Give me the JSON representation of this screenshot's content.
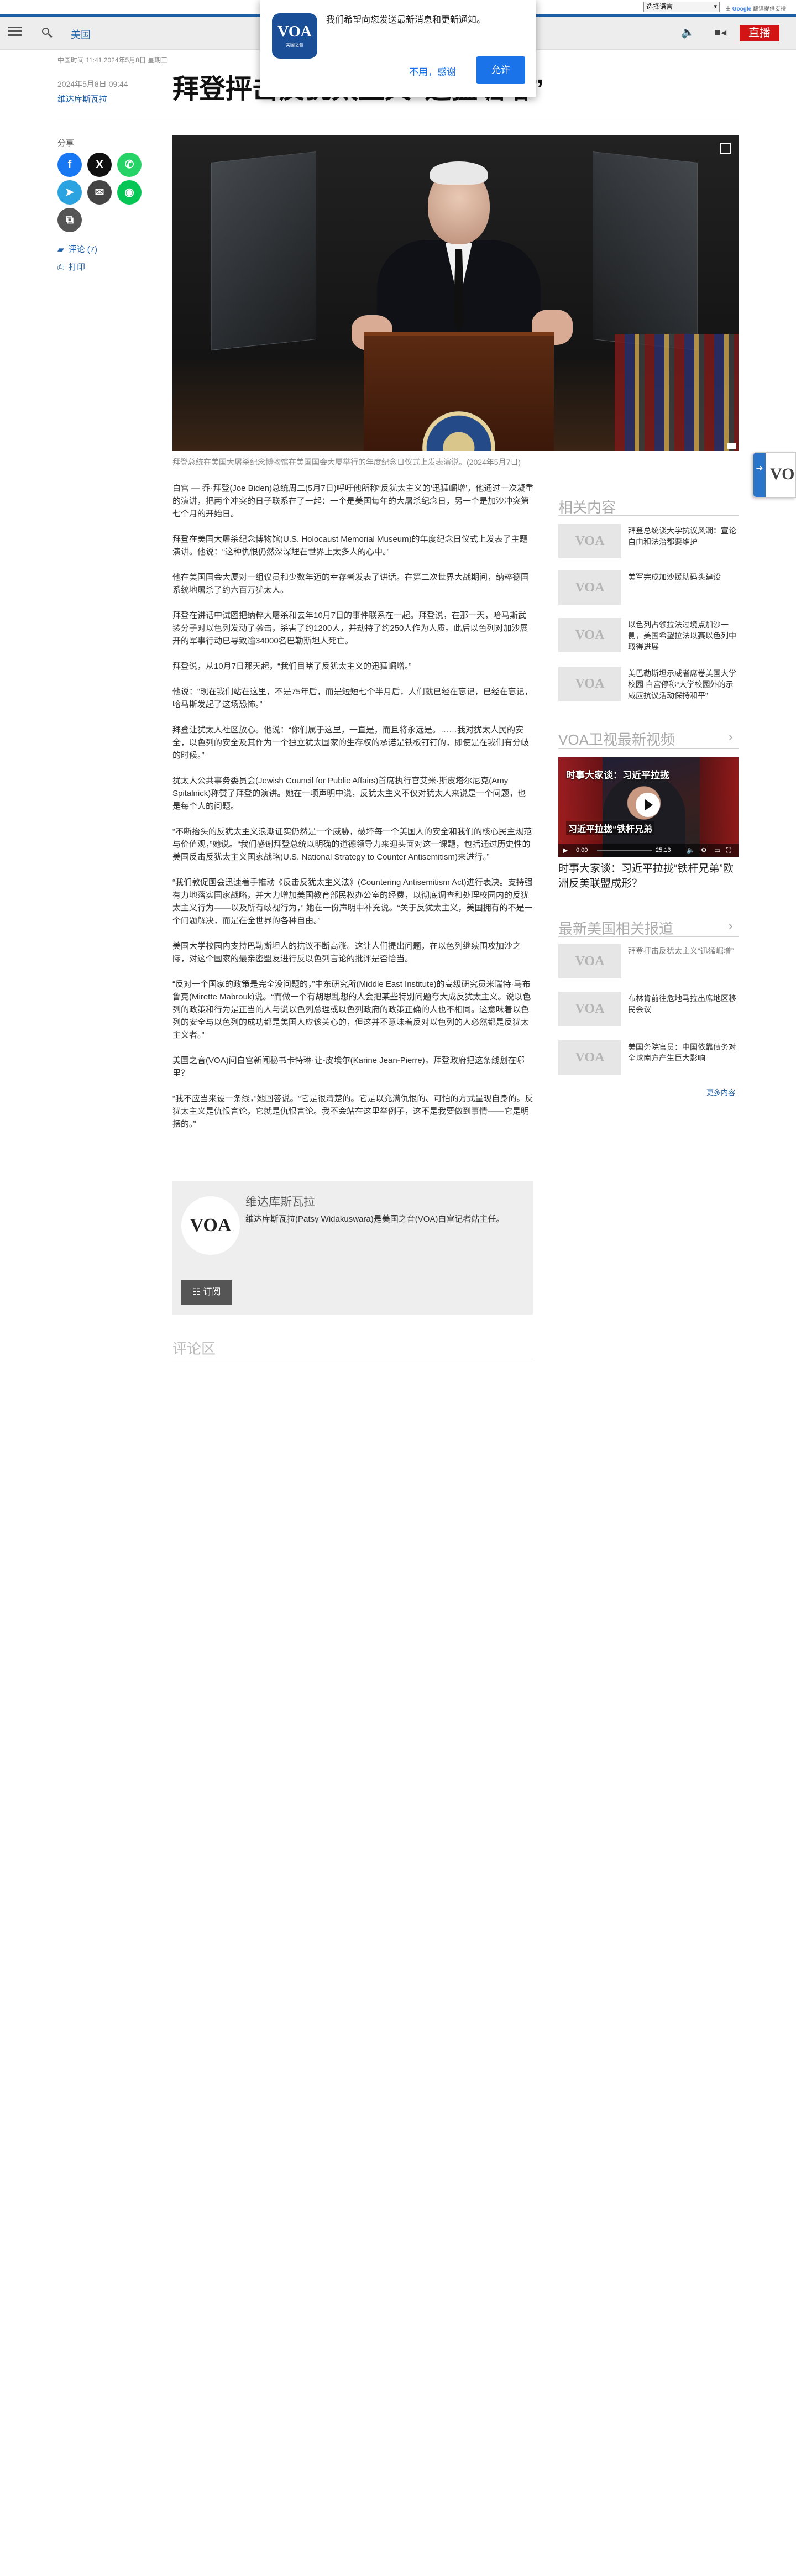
{
  "translate": {
    "select_label": "选择语言",
    "powered_prefix": "由",
    "powered_brand": "Google",
    "powered_suffix": "提供支持",
    "translate_label": "翻译"
  },
  "header": {
    "section": "美国",
    "live_label": "直播"
  },
  "notification": {
    "logo_text": "VOA",
    "logo_sub": "美国之音",
    "message": "我们希望向您发送最新消息和更新通知。",
    "deny_label": "不用，感谢",
    "allow_label": "允许"
  },
  "article": {
    "dateline": "中国时间 11:41 2024年5月8日 星期三",
    "pubdate": "2024年5月8日 09:44",
    "byline": "维达库斯瓦拉",
    "headline": "拜登抨击反犹太主义“迅猛崛增”",
    "caption": "拜登总统在美国大屠杀纪念博物馆在美国国会大厦举行的年度纪念日仪式上发表演说。(2024年5月7日)",
    "paragraphs": [
      "白宫 — 乔·拜登(Joe Biden)总统周二(5月7日)呼吁他所称“反犹太主义的‘迅猛崛增’，他通过一次凝重的演讲，把两个冲突的日子联系在了一起：一个是美国每年的大屠杀纪念日，另一个是加沙冲突第七个月的开始日。",
      "拜登在美国大屠杀纪念博物馆(U.S. Holocaust Memorial Museum)的年度纪念日仪式上发表了主题演讲。他说：“这种仇恨仍然深深埋在世界上太多人的心中。”",
      "他在美国国会大厦对一组议员和少数年迈的幸存者发表了讲话。在第二次世界大战期间，纳粹德国系统地屠杀了约六百万犹太人。",
      "拜登在讲话中试图把纳粹大屠杀和去年10月7日的事件联系在一起。拜登说，在那一天，哈马斯武装分子对以色列发动了袭击，杀害了约1200人，并劫持了约250人作为人质。此后以色列对加沙展开的军事行动已导致逾34000名巴勒斯坦人死亡。",
      "拜登说，从10月7日那天起，“我们目睹了反犹太主义的迅猛崛增。”",
      "他说：“现在我们站在这里，不是75年后，而是短短七个半月后，人们就已经在忘记，已经在忘记，哈马斯发起了这场恐怖。”",
      "拜登让犹太人社区放心。他说：“你们属于这里，一直是，而且将永远是。……我对犹太人民的安全，以色列的安全及其作为一个独立犹太国家的生存权的承诺是铁板钉钉的，即使是在我们有分歧的时候。”",
      "犹太人公共事务委员会(Jewish Council for Public Affairs)首席执行官艾米·斯皮塔尔尼克(Amy Spitalnick)称赞了拜登的演讲。她在一项声明中说，反犹太主义不仅对犹太人来说是一个问题，也是每个人的问题。",
      "“不断抬头的反犹太主义浪潮证实仍然是一个威胁，破坏每一个美国人的安全和我们的核心民主规范与价值观，”她说。“我们感谢拜登总统以明确的道德领导力来迎头面对这一课题，包括通过历史性的美国反击反犹太主义国家战略(U.S. National Strategy to Counter Antisemitism)来进行。”",
      "“我们敦促国会迅速着手推动《反击反犹太主义法》(Countering Antisemitism Act)进行表决。支持强有力地落实国家战略，并大力增加美国教育部民权办公室的经费，以彻底调查和处理校园内的反犹太主义行为——以及所有歧视行为，” 她在一份声明中补充说。“关于反犹太主义，美国拥有的不是一个问题解决，而是在全世界的各种自由。”",
      "美国大学校园内支持巴勒斯坦人的抗议不断高涨。这让人们提出问题，在以色列继续围攻加沙之际，对这个国家的最亲密盟友进行反以色列言论的批评是否恰当。",
      "“反对一个国家的政策是完全没问题的，”中东研究所(Middle East Institute)的高级研究员米瑞特·马布鲁克(Mirette Mabrouk)说。“而做一个有胡思乱想的人会把某些特别问题夸大成反犹太主义。说以色列的政策和行为是正当的人与说以色列总理或以色列政府的政策正确的人也不相同。这意味着以色列的安全与以色列的成功都是美国人应该关心的，但这并不意味着反对以色列的人必然都是反犹太主义者。”",
      "美国之音(VOA)问白宫新闻秘书卡特琳·让-皮埃尔(Karine Jean-Pierre)，拜登政府把这条线划在哪里？",
      "“我不应当来设一条线，”她回答说。“它是很清楚的。它是以充满仇恨的、可怕的方式呈现自身的。反犹太主义是仇恨言论，它就是仇恨言论。我不会站在这里举例子，这不是我要做到事情——它是明摆的。”"
    ]
  },
  "share": {
    "label": "分享",
    "comments_label": "评论 (7)",
    "print_label": "打印"
  },
  "author_box": {
    "logo_text": "VOA",
    "name": "维达库斯瓦拉",
    "bio": "维达库斯瓦拉(Patsy Widakuswara)是美国之音(VOA)白宫记者站主任。",
    "subscribe_label": "订阅"
  },
  "comments": {
    "title": "评论区"
  },
  "sidebar": {
    "related_title": "相关内容",
    "related": [
      {
        "thumb": "VOA",
        "text": "拜登总统谈大学抗议风潮：宣论自由和法治都要维护"
      },
      {
        "thumb": "VOA",
        "text": "美军完成加沙援助码头建设"
      },
      {
        "thumb": "VOA",
        "text": "以色列占领拉法过境点加沙一侧，美国希望拉法以赛以色列中取得进展"
      },
      {
        "thumb": "VOA",
        "text": "美巴勒斯坦示威者席卷美国大学校园 白宫停称“大学校园外的示威应抗议活动保持和平”"
      }
    ],
    "video_title": "VOA卫视最新视频",
    "video": {
      "banner": "时事大家谈：习近平拉拢",
      "banner2": "习近平拉拢“铁杆兄弟",
      "time_current": "0:00",
      "time_total": "25:13",
      "progress": 0,
      "title": "时事大家谈：习近平拉拢“铁杆兄弟”欧洲反美联盟成形？"
    },
    "latest_title": "最新美国相关报道",
    "latest": [
      {
        "thumb": "VOA",
        "text": "拜登抨击反犹太主义“迅猛崛增”",
        "muted": true
      },
      {
        "thumb": "VOA",
        "text": "布林肯前往危地马拉出席地区移民会议"
      },
      {
        "thumb": "VOA",
        "text": "美国务院官员：中国依靠债务对全球南方产生巨大影响"
      }
    ],
    "more_label": "更多内容"
  },
  "float_tab": {
    "logo_text": "VOA"
  },
  "colors": {
    "brand_blue": "#1d5ea8",
    "live_red": "#d21414",
    "allow_blue": "#1a73e8"
  }
}
